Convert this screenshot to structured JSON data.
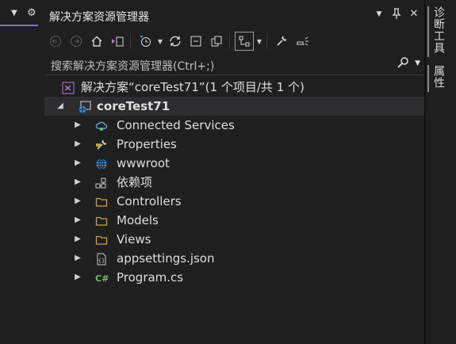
{
  "left": {
    "dropdown_glyph": "▼",
    "gear_glyph": "⚙"
  },
  "window": {
    "title": "解决方案资源管理器"
  },
  "title_buttons": {
    "dropdown": "▼",
    "pin": "📌",
    "close": "✕"
  },
  "toolbar": [
    {
      "name": "back-button",
      "glyph": "←",
      "disabled": true
    },
    {
      "name": "forward-button",
      "glyph": "→",
      "disabled": true
    },
    {
      "name": "home-button",
      "glyph": "⌂",
      "disabled": false
    },
    {
      "name": "switch-views-button",
      "glyph": "⇄",
      "disabled": false
    },
    {
      "name": "pending-changes-filter-button",
      "glyph": "⏲",
      "disabled": false
    },
    {
      "name": "sync-button",
      "glyph": "↻",
      "disabled": false
    },
    {
      "name": "collapse-all-button",
      "glyph": "▭",
      "disabled": false
    },
    {
      "name": "show-all-files-button",
      "glyph": "⧉",
      "disabled": false
    },
    {
      "name": "preview-selected-button",
      "glyph": "⛓",
      "disabled": false
    },
    {
      "name": "properties-button",
      "glyph": "🔧",
      "disabled": false
    },
    {
      "name": "preview-button",
      "glyph": "⩏",
      "disabled": false
    }
  ],
  "search": {
    "placeholder": "搜索解决方案资源管理器(Ctrl+;)",
    "search_glyph": "⚲",
    "dropdown": "▼"
  },
  "tree": {
    "solution": "解决方案“coreTest71”(1 个项目/共 1 个)",
    "project": "coreTest71",
    "items": [
      {
        "label": "Connected Services",
        "icon": "connected-services-icon",
        "color": "#55a6e0",
        "glyph": "☁"
      },
      {
        "label": "Properties",
        "icon": "wrench-icon",
        "color": "#d0d0d0",
        "glyph": "🔧"
      },
      {
        "label": "wwwroot",
        "icon": "globe-icon",
        "color": "#3c8de0",
        "glyph": "◍"
      },
      {
        "label": "依赖项",
        "icon": "dependencies-icon",
        "color": "#c9c9c9",
        "glyph": "⚯"
      },
      {
        "label": "Controllers",
        "icon": "folder-icon",
        "color": "#c9a14a",
        "glyph": "▭"
      },
      {
        "label": "Models",
        "icon": "folder-icon",
        "color": "#c9a14a",
        "glyph": "▭"
      },
      {
        "label": "Views",
        "icon": "folder-icon",
        "color": "#c9a14a",
        "glyph": "▭"
      },
      {
        "label": "appsettings.json",
        "icon": "json-file-icon",
        "color": "#c9c9c9",
        "glyph": "{}"
      },
      {
        "label": "Program.cs",
        "icon": "csharp-file-icon",
        "color": "#6dbf67",
        "glyph": "C#"
      }
    ]
  },
  "side_tabs": {
    "diagnostics": "诊断工具",
    "properties": "属性"
  },
  "colors": {
    "background": "#1f1f1f",
    "selected_row": "#2d2d30",
    "accent": "#7a6fd1"
  }
}
